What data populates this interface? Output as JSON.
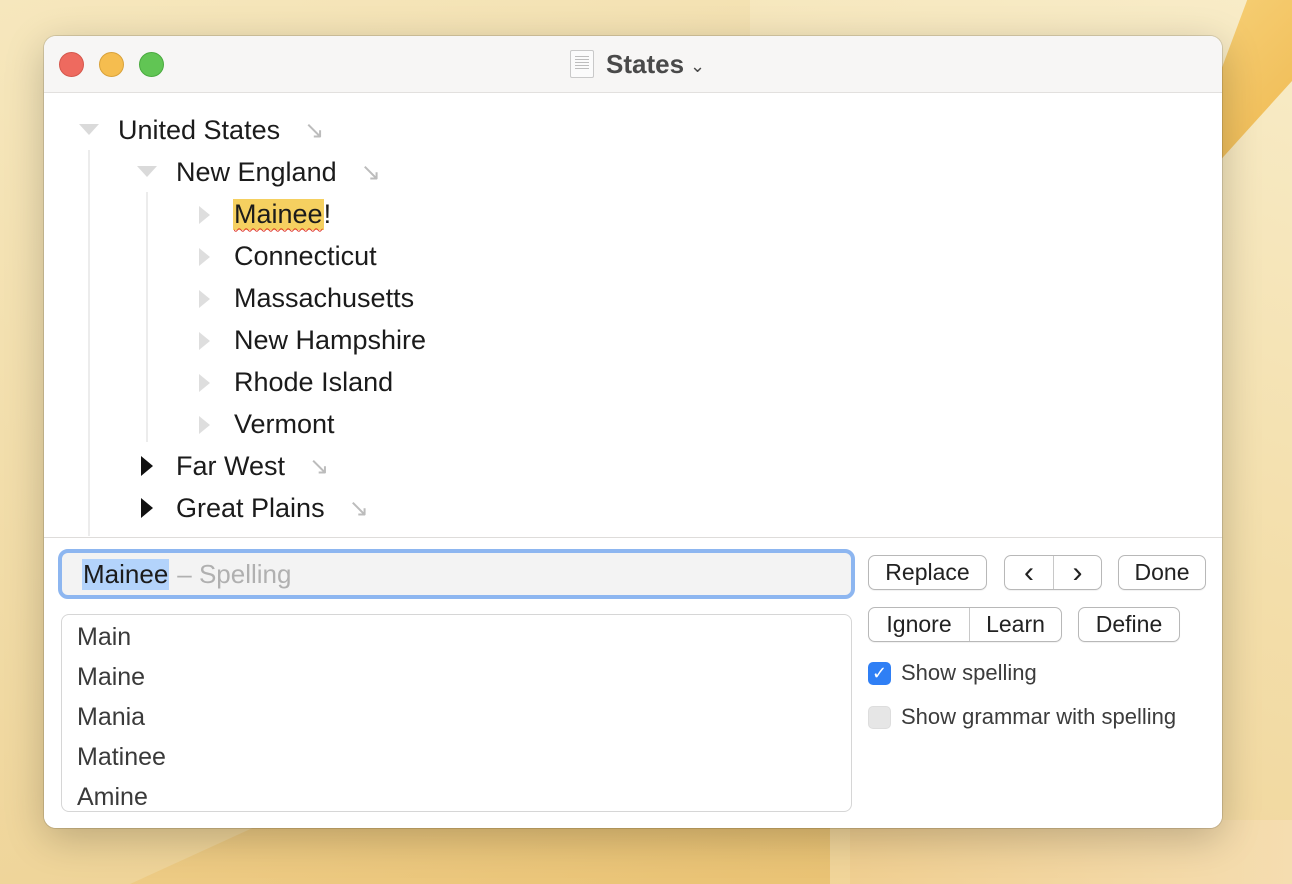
{
  "window": {
    "title": "States"
  },
  "outline": {
    "root": {
      "label": "United States",
      "arrow": "↘"
    },
    "group": {
      "label": "New England",
      "arrow": "↘"
    },
    "children": [
      {
        "label": "Mainee",
        "suffix": "!"
      },
      {
        "label": "Connecticut"
      },
      {
        "label": "Massachusetts"
      },
      {
        "label": "New Hampshire"
      },
      {
        "label": "Rhode Island"
      },
      {
        "label": "Vermont"
      }
    ],
    "collapsed": [
      {
        "label": "Far West",
        "arrow": "↘"
      },
      {
        "label": "Great Plains",
        "arrow": "↘"
      }
    ]
  },
  "spelling": {
    "word": "Mainee",
    "mode": "– Spelling",
    "suggestions": [
      "Main",
      "Maine",
      "Mania",
      "Matinee",
      "Amine"
    ],
    "buttons": {
      "replace": "Replace",
      "prev": "‹",
      "next": "›",
      "done": "Done",
      "ignore": "Ignore",
      "learn": "Learn",
      "define": "Define"
    },
    "show_spelling": {
      "label": "Show spelling",
      "checked": true
    },
    "show_grammar": {
      "label": "Show grammar with spelling",
      "checked": false
    }
  },
  "colors": {
    "highlight": "#f5d060",
    "focus_ring": "#8db6f0",
    "checkbox_on": "#2f7ff5"
  }
}
